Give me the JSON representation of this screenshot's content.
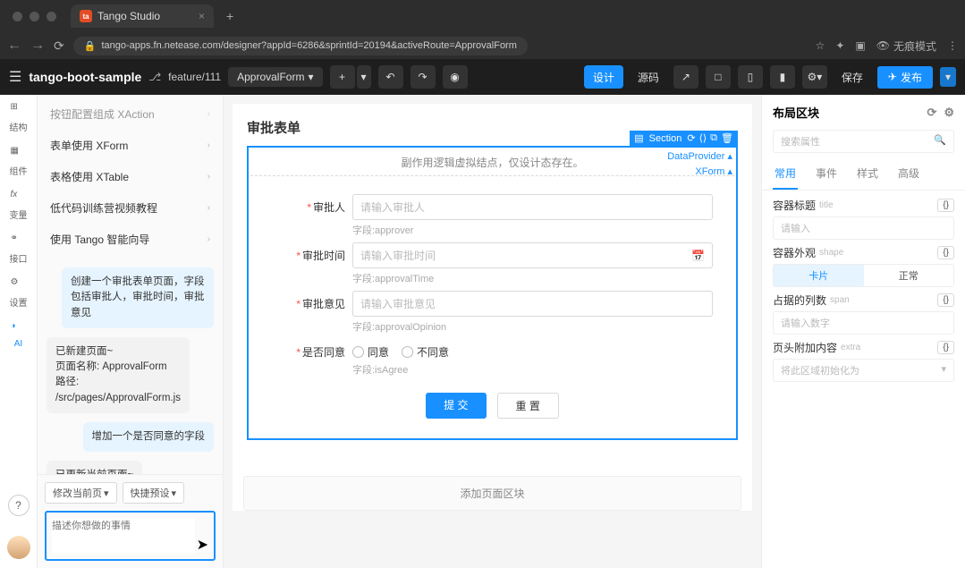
{
  "browser": {
    "tab_title": "Tango Studio",
    "tab_icon_text": "ta",
    "url": "tango-apps.fn.netease.com/designer?appId=6286&sprintId=20194&activeRoute=ApprovalForm",
    "incognito_label": "无痕模式"
  },
  "toolbar": {
    "app_name": "tango-boot-sample",
    "branch": "feature/111",
    "route": "ApprovalForm",
    "design_label": "设计",
    "source_label": "源码",
    "save_label": "保存",
    "publish_label": "发布"
  },
  "rail": {
    "items": [
      {
        "label": "结构"
      },
      {
        "label": "组件"
      },
      {
        "label": "变量"
      },
      {
        "label": "接口"
      },
      {
        "label": "设置"
      },
      {
        "label": "AI"
      }
    ]
  },
  "guide": {
    "items": [
      {
        "label": "按钮配置组成 XAction"
      },
      {
        "label": "表单使用 XForm"
      },
      {
        "label": "表格使用 XTable"
      },
      {
        "label": "低代码训练营视频教程"
      },
      {
        "label": "使用 Tango 智能向导"
      }
    ]
  },
  "chat": {
    "messages": [
      {
        "role": "user",
        "text": "创建一个审批表单页面，字段包括审批人，审批时间，审批意见"
      },
      {
        "role": "bot",
        "text": "已新建页面~\n页面名称: ApprovalForm\n路径:\n/src/pages/ApprovalForm.js"
      },
      {
        "role": "user",
        "text": "增加一个是否同意的字段"
      },
      {
        "role": "bot",
        "text": "已更新当前页面~"
      }
    ],
    "modify_btn": "修改当前页",
    "preset_btn": "快捷预设",
    "placeholder": "描述你想做的事情"
  },
  "canvas": {
    "page_title": "审批表单",
    "section_label": "Section",
    "dp_label": "DataProvider",
    "xform_label": "XForm",
    "form_hint": "副作用逻辑虚拟结点，仅设计态存在。",
    "fields": [
      {
        "label": "审批人",
        "placeholder": "请输入审批人",
        "meta": "字段:approver",
        "type": "text",
        "required": true
      },
      {
        "label": "审批时间",
        "placeholder": "请输入审批时间",
        "meta": "字段:approvalTime",
        "type": "date",
        "required": true
      },
      {
        "label": "审批意见",
        "placeholder": "请输入审批意见",
        "meta": "字段:approvalOpinion",
        "type": "text",
        "required": true
      },
      {
        "label": "是否同意",
        "meta": "字段:isAgree",
        "type": "radio",
        "required": true
      }
    ],
    "radio_options": [
      "同意",
      "不同意"
    ],
    "submit_label": "提 交",
    "reset_label": "重 置",
    "add_section_label": "添加页面区块"
  },
  "props": {
    "header": "布局区块",
    "search_placeholder": "搜索属性",
    "tabs": [
      "常用",
      "事件",
      "样式",
      "高级"
    ],
    "rows": [
      {
        "label": "容器标题",
        "meta": "title",
        "input": {
          "type": "text",
          "placeholder": "请输入"
        }
      },
      {
        "label": "容器外观",
        "meta": "shape",
        "input": {
          "type": "seg",
          "options": [
            "卡片",
            "正常"
          ],
          "active": 0
        }
      },
      {
        "label": "占据的列数",
        "meta": "span",
        "input": {
          "type": "text",
          "placeholder": "请输入数字"
        }
      },
      {
        "label": "页头附加内容",
        "meta": "extra",
        "input": {
          "type": "select",
          "placeholder": "将此区域初始化为"
        }
      }
    ]
  }
}
